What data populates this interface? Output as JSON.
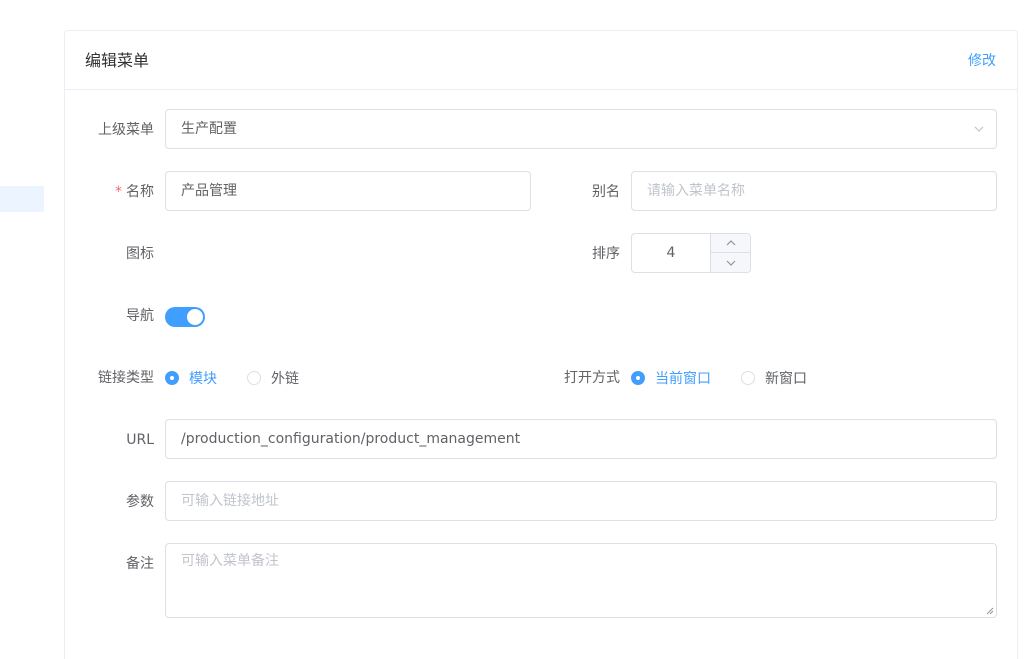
{
  "card": {
    "title": "编辑菜单",
    "action": "修改"
  },
  "form": {
    "parent_menu": {
      "label": "上级菜单",
      "value": "生产配置"
    },
    "name": {
      "label": "名称",
      "required_mark": "*",
      "value": "产品管理"
    },
    "alias": {
      "label": "别名",
      "placeholder": "请输入菜单名称"
    },
    "icon": {
      "label": "图标"
    },
    "order": {
      "label": "排序",
      "value": "4"
    },
    "nav": {
      "label": "导航",
      "enabled": true
    },
    "link_type": {
      "label": "链接类型",
      "options": [
        "模块",
        "外链"
      ],
      "selected": "模块"
    },
    "open_mode": {
      "label": "打开方式",
      "options": [
        "当前窗口",
        "新窗口"
      ],
      "selected": "当前窗口"
    },
    "url": {
      "label": "URL",
      "value": "/production_configuration/product_management"
    },
    "params": {
      "label": "参数",
      "placeholder": "可输入链接地址"
    },
    "remark": {
      "label": "备注",
      "placeholder": "可输入菜单备注"
    }
  },
  "colors": {
    "primary": "#409eff",
    "required": "#f56c6c",
    "border": "#dcdfe6",
    "sidebar_active": "#ecf5ff"
  }
}
